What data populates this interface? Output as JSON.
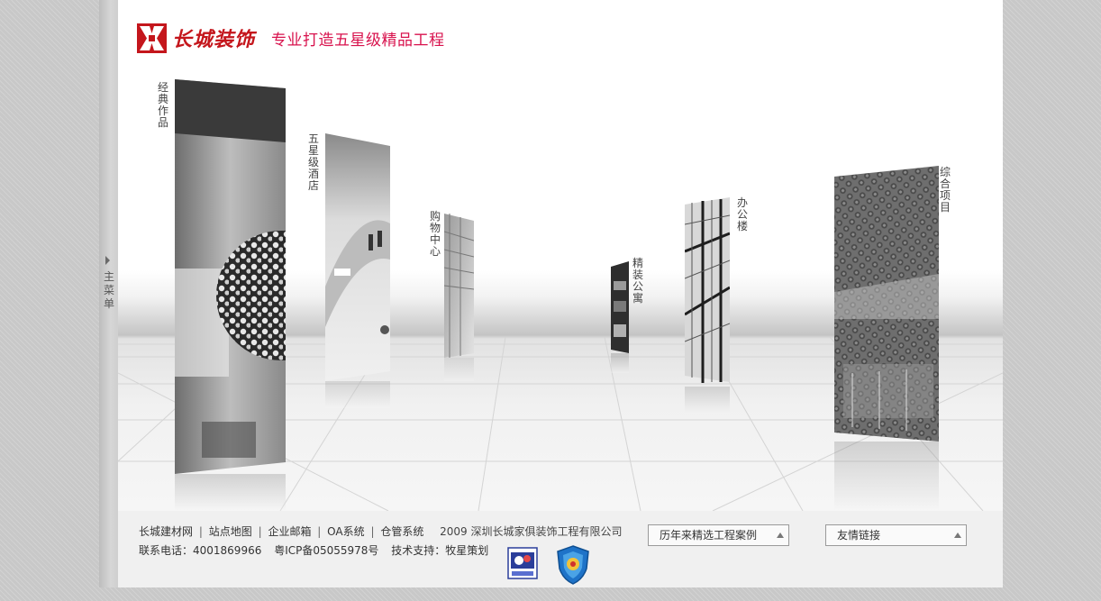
{
  "side_menu": {
    "label": "主菜单"
  },
  "header": {
    "brand": "长城装饰",
    "slogan": "专业打造五星级精品工程"
  },
  "panels": [
    {
      "id": "classic",
      "label": "经典作品"
    },
    {
      "id": "hotel",
      "label": "五星级酒店"
    },
    {
      "id": "mall",
      "label": "购物中心"
    },
    {
      "id": "apartment",
      "label": "精装公寓"
    },
    {
      "id": "office",
      "label": "办公楼"
    },
    {
      "id": "complex",
      "label": "综合项目"
    }
  ],
  "footer": {
    "links": [
      "长城建材网",
      "站点地图",
      "企业邮箱",
      "OA系统",
      "仓管系统"
    ],
    "copyright": "2009 深圳长城家俱装饰工程有限公司",
    "phone": "联系电话：4001869966",
    "icp": "粤ICP备05055978号",
    "support": "技术支持：牧星策划",
    "select_cases": "历年来精选工程案例",
    "select_links": "友情链接"
  }
}
